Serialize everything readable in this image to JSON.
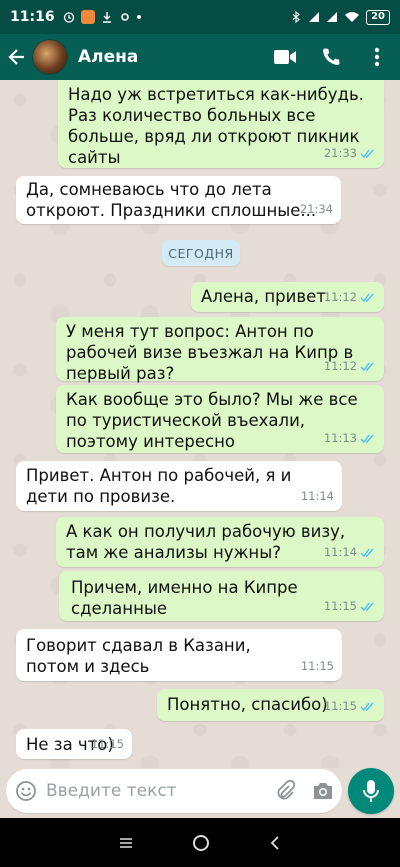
{
  "status_bar": {
    "time": "11:16",
    "battery": "20"
  },
  "header": {
    "contact_name": "Алена"
  },
  "day_divider": "СЕГОДНЯ",
  "messages": [
    {
      "text": "Надо уж встретиться как-нибудь. Раз количество больных все больше, вряд ли откроют пикник сайты",
      "time": "21:33",
      "direction": "outgoing",
      "status": "read"
    },
    {
      "text": "Да, сомневаюсь что до лета откроют. Праздники сплошные...",
      "time": "21:34",
      "direction": "incoming"
    },
    {
      "text": "Алена, привет",
      "time": "11:12",
      "direction": "outgoing",
      "status": "read"
    },
    {
      "text": "У меня тут вопрос: Антон по рабочей визе въезжал на Кипр в первый раз?",
      "time": "11:12",
      "direction": "outgoing",
      "status": "read"
    },
    {
      "text": "Как вообще это было? Мы же все по туристической въехали, поэтому интересно",
      "time": "11:13",
      "direction": "outgoing",
      "status": "read"
    },
    {
      "text": "Привет. Антон по рабочей, я и дети по провизе.",
      "time": "11:14",
      "direction": "incoming"
    },
    {
      "text": "А как он получил рабочую визу, там же анализы нужны?",
      "time": "11:14",
      "direction": "outgoing",
      "status": "read"
    },
    {
      "text": "Причем, именно на Кипре сделанные",
      "time": "11:15",
      "direction": "outgoing",
      "status": "read"
    },
    {
      "text": "Говорит сдавал в Казани, потом и здесь",
      "time": "11:15",
      "direction": "incoming"
    },
    {
      "text": "Понятно, спасибо)",
      "time": "11:15",
      "direction": "outgoing",
      "status": "read"
    },
    {
      "text": "Не за что)",
      "time": "11:15",
      "direction": "incoming"
    }
  ],
  "composer": {
    "placeholder": "Введите текст"
  },
  "colors": {
    "header": "#075e54",
    "status_bar": "#054d44",
    "outgoing_bubble": "#dcf8c6",
    "incoming_bubble": "#ffffff",
    "read_ticks": "#4fc3f7",
    "mic_button": "#00897b"
  },
  "icons": [
    "back-arrow-icon",
    "video-call-icon",
    "phone-icon",
    "more-vert-icon",
    "emoji-icon",
    "attach-icon",
    "camera-icon",
    "mic-icon",
    "read-ticks-icon"
  ]
}
